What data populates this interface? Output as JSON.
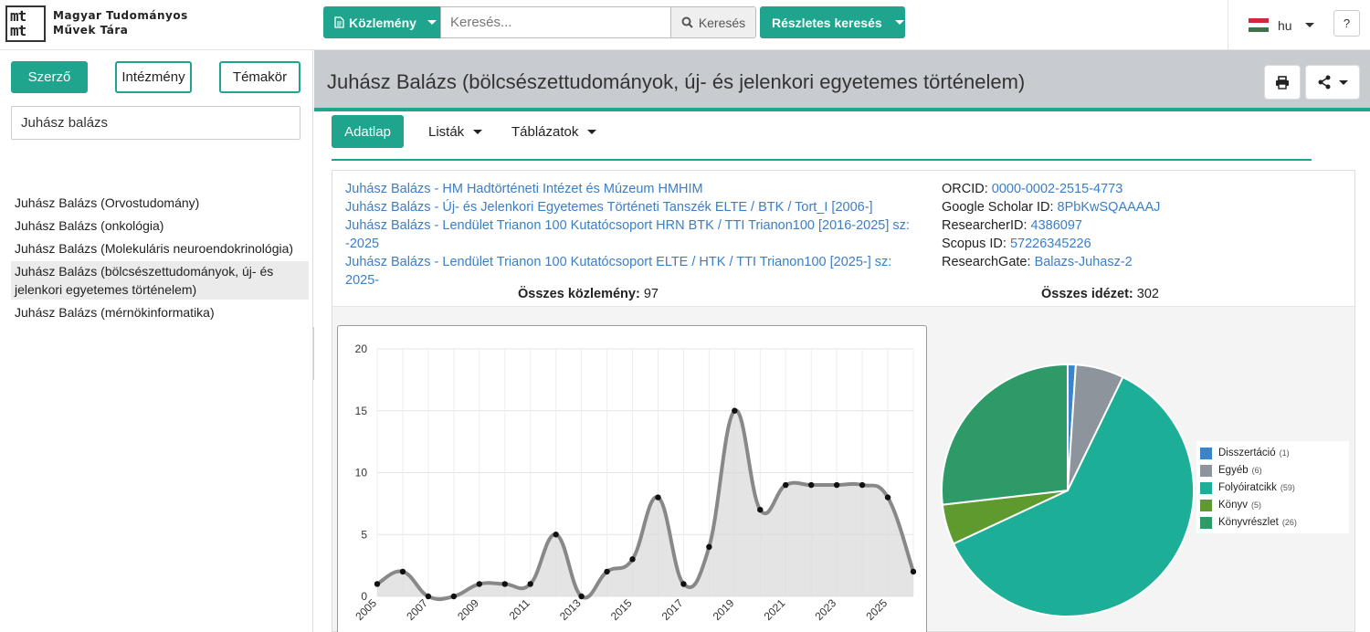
{
  "header": {
    "logo_mark_line1": "mt",
    "logo_mark_line2": "mt",
    "logo_line1": "Magyar Tudományos",
    "logo_line2": "Művek Tára",
    "kozlemeny_label": "Közlemény",
    "search_placeholder": "Keresés...",
    "search_button": "Keresés",
    "advanced_search": "Részletes keresés",
    "lang": "hu",
    "help": "?"
  },
  "sidebar": {
    "tabs": [
      {
        "label": "Szerző",
        "active": true
      },
      {
        "label": "Intézmény",
        "active": false
      },
      {
        "label": "Témakör",
        "active": false
      }
    ],
    "search_value": "Juhász balázs",
    "results": [
      "Juhász Balázs (Orvostudomány)",
      "Juhász Balázs (onkológia)",
      "Juhász Balázs (Molekuláris neuroendokrinológia)",
      "Juhász Balázs (bölcsészettudományok, új- és jelenkori egyetemes történelem)",
      "Juhász Balázs (mérnökinformatika)"
    ],
    "selected_index": 3
  },
  "main": {
    "title": "Juhász Balázs (bölcsészettudományok, új- és jelenkori egyetemes történelem)",
    "tabs": [
      {
        "label": "Adatlap",
        "active": true
      },
      {
        "label": "Listák",
        "active": false
      },
      {
        "label": "Táblázatok",
        "active": false
      }
    ],
    "affiliations": [
      "Juhász Balázs - HM Hadtörténeti Intézet és Múzeum HMHIM",
      "Juhász Balázs - Új- és Jelenkori Egyetemes Történeti Tanszék ELTE / BTK / Tort_I [2006-]",
      "Juhász Balázs - Lendület Trianon 100 Kutatócsoport HRN BTK / TTI Trianon100 [2016-2025] sz:",
      "-2025",
      "Juhász Balázs - Lendület Trianon 100 Kutatócsoport ELTE / HTK / TTI Trianon100 [2025-] sz: 2025-"
    ],
    "ids": [
      {
        "label": "ORCID:",
        "value": "0000-0002-2515-4773"
      },
      {
        "label": "Google Scholar ID:",
        "value": "8PbKwSQAAAAJ"
      },
      {
        "label": "ResearcherID:",
        "value": "4386097"
      },
      {
        "label": "Scopus ID:",
        "value": "57226345226"
      },
      {
        "label": "ResearchGate:",
        "value": "Balazs-Juhasz-2"
      }
    ],
    "total_publications_label": "Összes közlemény:",
    "total_publications": "97",
    "total_citations_label": "Összes idézet:",
    "total_citations": "302"
  },
  "colors": {
    "accent": "#1fa58e",
    "link": "#3b7ec6"
  },
  "chart_data": [
    {
      "type": "area",
      "x": [
        2005,
        2006,
        2007,
        2008,
        2009,
        2010,
        2011,
        2012,
        2013,
        2014,
        2015,
        2016,
        2017,
        2018,
        2019,
        2020,
        2021,
        2022,
        2023,
        2024,
        2025,
        2026
      ],
      "x_tick_labels": [
        "2005",
        "2007",
        "2009",
        "2011",
        "2013",
        "2015",
        "2017",
        "2019",
        "2021",
        "2023",
        "2025"
      ],
      "values": [
        1,
        2,
        0,
        0,
        1,
        1,
        1,
        5,
        0,
        2,
        3,
        8,
        1,
        4,
        15,
        7,
        9,
        9,
        9,
        9,
        8,
        2
      ],
      "ylim": [
        0,
        20
      ],
      "y_ticks": [
        0,
        5,
        10,
        15,
        20
      ],
      "grid": true
    },
    {
      "type": "pie",
      "legend_position": "right",
      "slices": [
        {
          "label": "Disszertáció",
          "value": 1,
          "color": "#3a85c9"
        },
        {
          "label": "Egyéb",
          "value": 6,
          "color": "#8e949b"
        },
        {
          "label": "Folyóiratcikk",
          "value": 59,
          "color": "#1dae98"
        },
        {
          "label": "Könyv",
          "value": 5,
          "color": "#5f9a2e"
        },
        {
          "label": "Könyvrészlet",
          "value": 26,
          "color": "#2d9a68"
        }
      ]
    }
  ]
}
